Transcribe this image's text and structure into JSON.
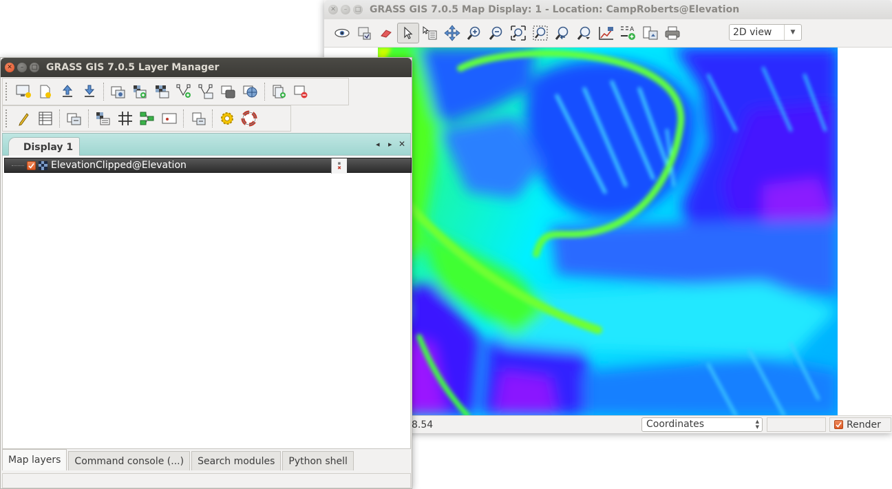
{
  "map_window": {
    "title": "GRASS GIS 7.0.5 Map Display: 1 - Location: CampRoberts@Elevation",
    "toolbar": {
      "view_select": "2D view",
      "icons": [
        "eye-icon",
        "render-map-icon",
        "eraser-icon",
        "pointer-icon",
        "query-icon",
        "pan-icon",
        "zoom-in-icon",
        "zoom-out-icon",
        "zoom-extent-icon",
        "zoom-box-icon",
        "zoom-back-icon",
        "zoom-menu-icon",
        "analyze-icon",
        "decoration-icon",
        "save-image-icon",
        "print-icon"
      ]
    },
    "status": {
      "coordinate_text": "8.54",
      "mode_select": "Coordinates",
      "render_label": "Render",
      "render_checked": true
    },
    "raster_colors": [
      "#ff00ff",
      "#0000ff",
      "#00ffff",
      "#00ff00",
      "#ffff00"
    ]
  },
  "layer_manager": {
    "title": "GRASS GIS 7.0.5 Layer Manager",
    "toolbar_row1": [
      "new-display-icon",
      "new-workspace-icon",
      "open-workspace-icon",
      "save-workspace-icon",
      "add-raster-icon",
      "add-multiple-raster-icon",
      "add-raster-misc-icon",
      "add-vector-icon",
      "add-multiple-vector-icon",
      "add-overlay-icon",
      "add-wms-icon",
      "add-group-icon",
      "remove-layer-icon"
    ],
    "toolbar_row2": [
      "edit-vector-icon",
      "attribute-table-icon",
      "map-calculator-icon",
      "raster-legend-icon",
      "grid-icon",
      "modeler-icon",
      "ps-map-icon",
      "script-icon",
      "settings-icon",
      "help-icon"
    ],
    "notebook_tab": "Display 1",
    "layers": [
      {
        "name": "ElevationClipped@Elevation",
        "checked": true
      }
    ],
    "bottom_tabs": [
      "Map layers",
      "Command console (...)",
      "Search modules",
      "Python shell"
    ],
    "active_bottom_tab": "Map layers"
  }
}
